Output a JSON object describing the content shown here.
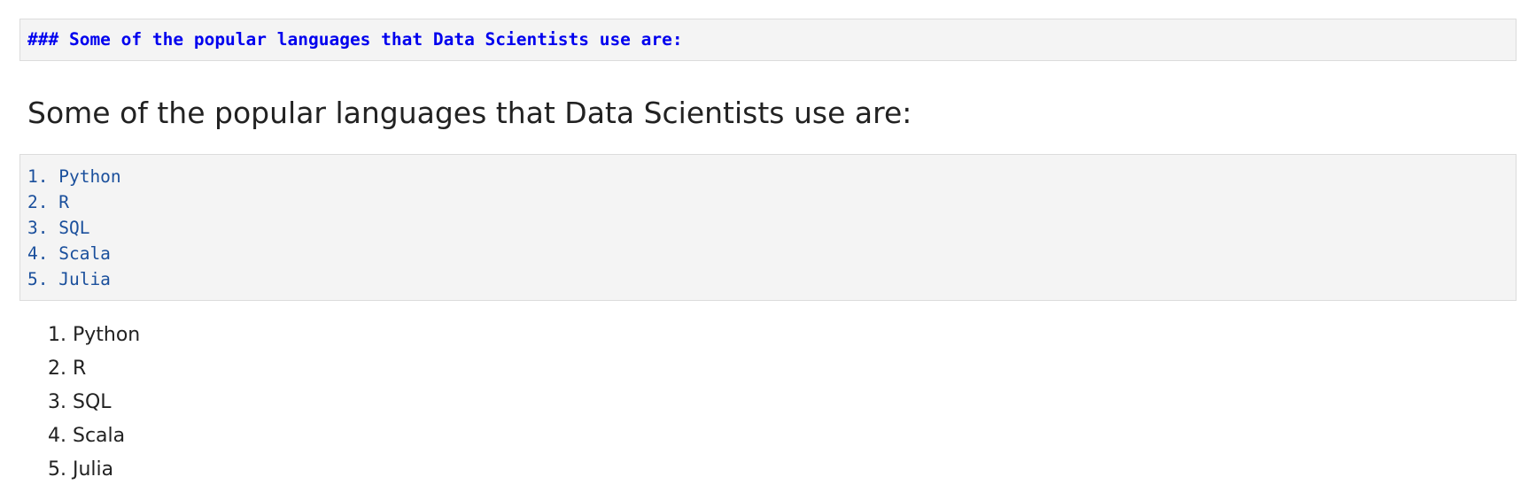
{
  "heading_cell": {
    "source_text": "### Some of the popular languages that Data Scientists use are:",
    "rendered_text": "Some of the popular languages that Data Scientists use are:"
  },
  "list_cell": {
    "source_lines": [
      "1. Python",
      "2. R",
      "3. SQL",
      "4. Scala",
      "5. Julia"
    ],
    "rendered_items": [
      "1. Python",
      "2. R",
      "3. SQL",
      "4. Scala",
      "5. Julia"
    ]
  },
  "colors": {
    "source_heading": "#0000ee",
    "source_list": "#1a4f9c",
    "cell_background": "#f4f4f4",
    "rendered_text": "#222222"
  }
}
